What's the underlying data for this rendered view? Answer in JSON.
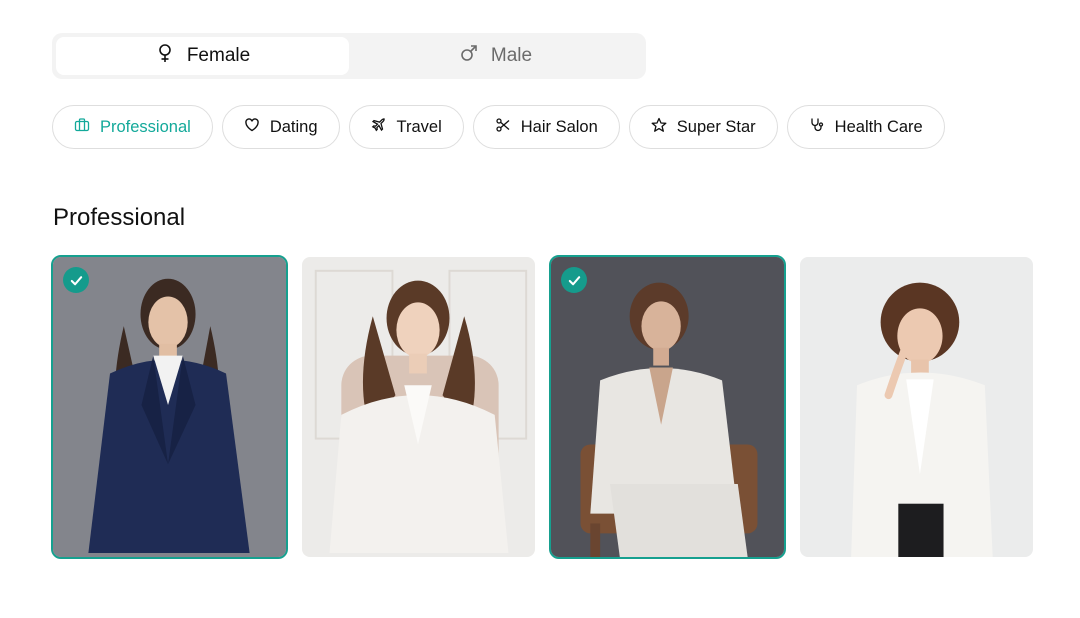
{
  "gender": {
    "options": [
      {
        "label": "Female",
        "icon": "female-icon",
        "active": true
      },
      {
        "label": "Male",
        "icon": "male-icon",
        "active": false
      }
    ]
  },
  "categories": [
    {
      "label": "Professional",
      "icon": "briefcase-icon",
      "active": true
    },
    {
      "label": "Dating",
      "icon": "heart-icon",
      "active": false
    },
    {
      "label": "Travel",
      "icon": "airplane-icon",
      "active": false
    },
    {
      "label": "Hair Salon",
      "icon": "scissors-icon",
      "active": false
    },
    {
      "label": "Super Star",
      "icon": "star-icon",
      "active": false
    },
    {
      "label": "Health Care",
      "icon": "stethoscope-icon",
      "active": false
    }
  ],
  "section": {
    "title": "Professional"
  },
  "photos": [
    {
      "selected": true,
      "description_icon": "portrait-photo"
    },
    {
      "selected": false,
      "description_icon": "portrait-photo"
    },
    {
      "selected": true,
      "description_icon": "portrait-photo"
    },
    {
      "selected": false,
      "description_icon": "portrait-photo"
    }
  ],
  "colors": {
    "accent": "#13a99a",
    "selected_border": "#16a08f"
  }
}
